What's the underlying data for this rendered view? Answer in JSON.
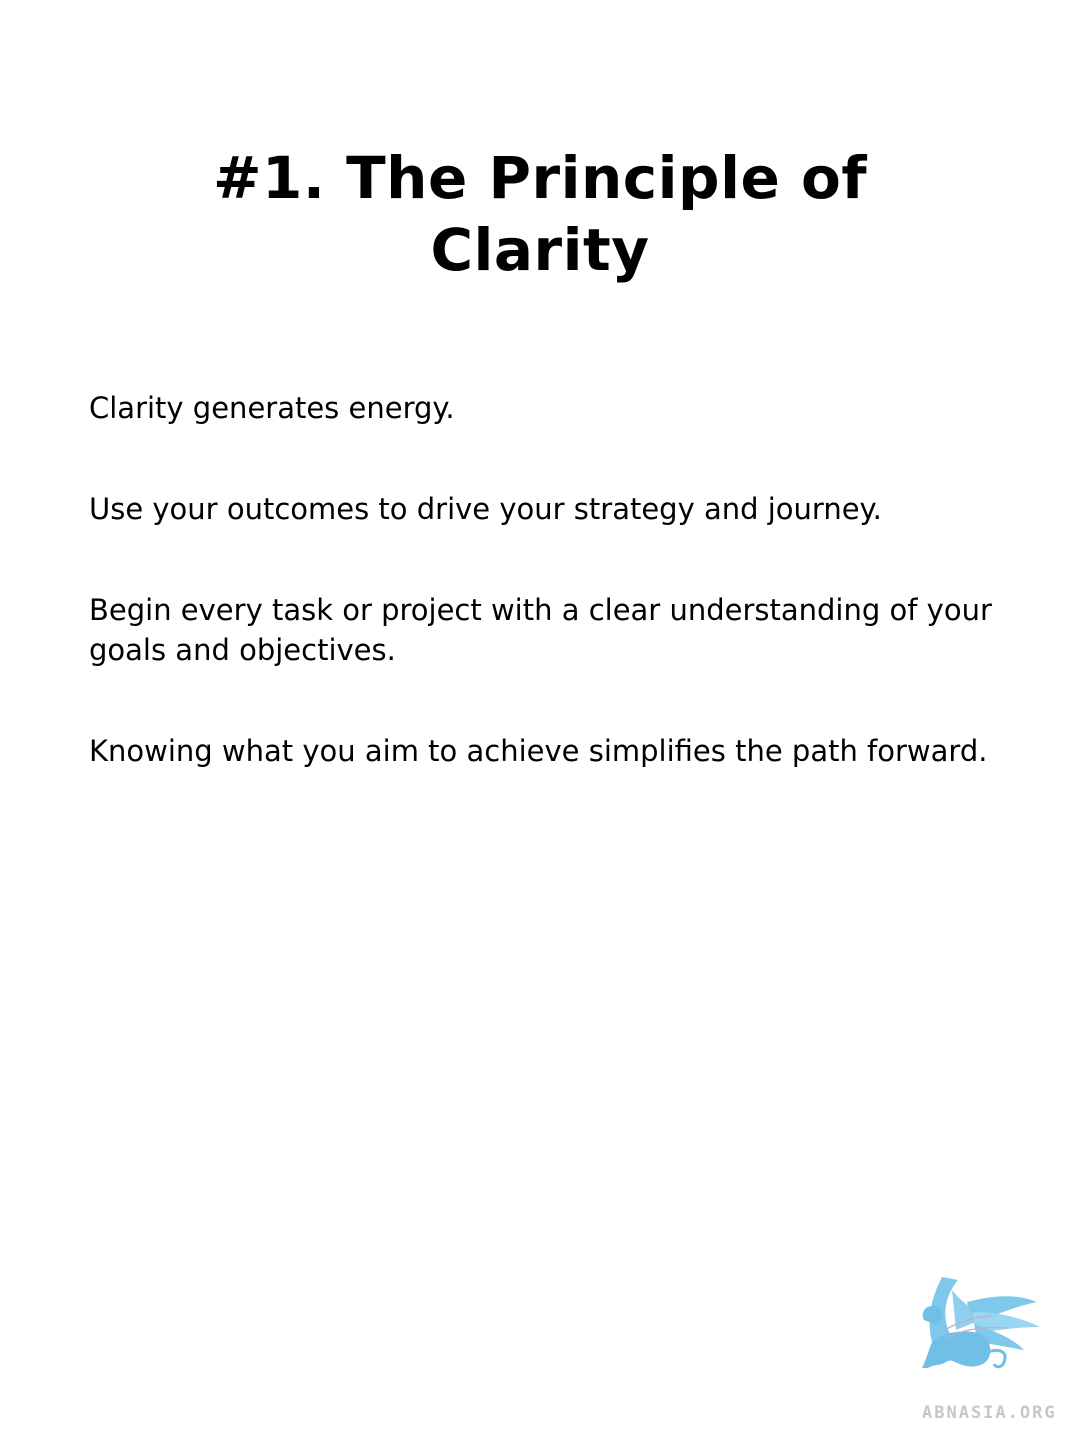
{
  "slide": {
    "title_lines": [
      "#1. The Principle of",
      "Clarity"
    ],
    "paragraphs": [
      "Clarity generates energy.",
      "Use your outcomes to drive your strategy and journey.",
      "Begin every task or project with a clear understanding of your goals and objectives.",
      "Knowing what you aim to achieve simplifies the path forward."
    ]
  },
  "watermark": {
    "icon": "griffin-logo-icon",
    "text": "ABNASIA.ORG",
    "color": "#7ec8ea"
  }
}
